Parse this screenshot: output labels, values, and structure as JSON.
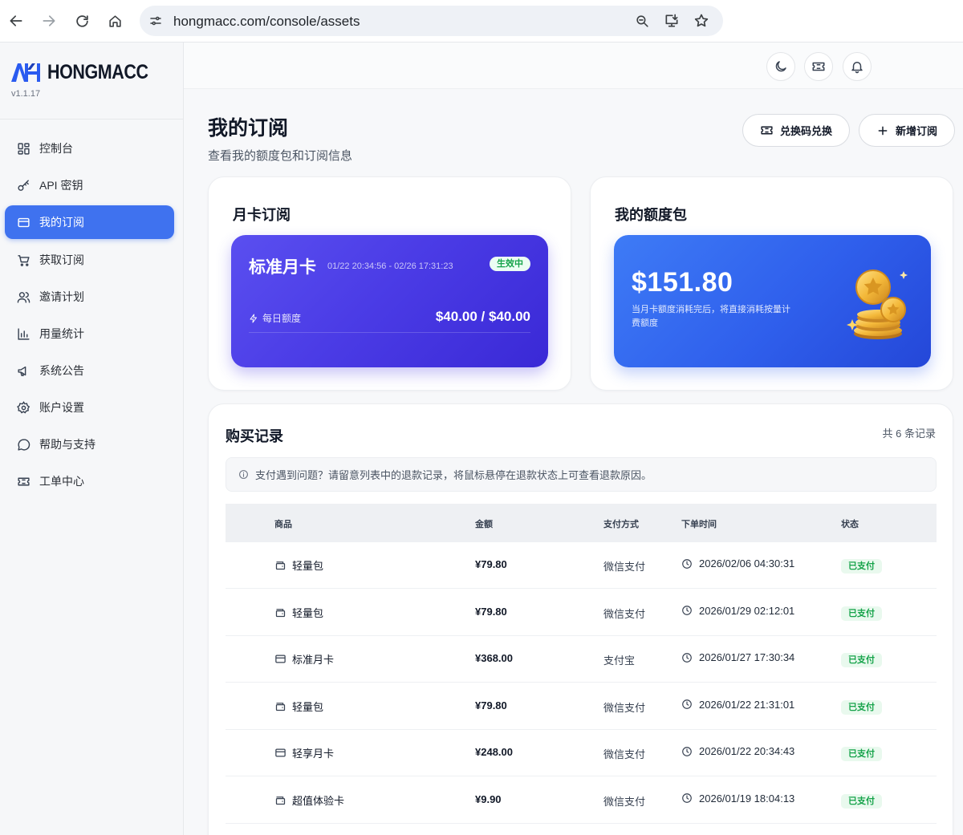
{
  "browser": {
    "url": "hongmacc.com/console/assets"
  },
  "brand": {
    "name": "HONGMACC",
    "version": "v1.1.17"
  },
  "sidebar": {
    "items": [
      {
        "label": "控制台",
        "icon": "dashboard-icon"
      },
      {
        "label": "API 密钥",
        "icon": "key-icon"
      },
      {
        "label": "我的订阅",
        "icon": "card-icon",
        "active": true
      },
      {
        "label": "获取订阅",
        "icon": "cart-icon"
      },
      {
        "label": "邀请计划",
        "icon": "users-icon"
      },
      {
        "label": "用量统计",
        "icon": "bar-chart-icon"
      },
      {
        "label": "系统公告",
        "icon": "megaphone-icon"
      },
      {
        "label": "账户设置",
        "icon": "gear-icon"
      },
      {
        "label": "帮助与支持",
        "icon": "chat-icon"
      },
      {
        "label": "工单中心",
        "icon": "ticket-icon"
      }
    ]
  },
  "page": {
    "title": "我的订阅",
    "subtitle": "查看我的额度包和订阅信息",
    "redeem_label": "兑换码兑换",
    "add_label": "新增订阅"
  },
  "subscription": {
    "title": "月卡订阅",
    "plan_name": "标准月卡",
    "range": "01/22 20:34:56 - 02/26 17:31:23",
    "status": "生效中",
    "daily_label": "每日额度",
    "daily_value": "$40.00 / $40.00"
  },
  "quota": {
    "title": "我的额度包",
    "amount": "$151.80",
    "note": "当月卡额度消耗完后，将直接消耗按量计费额度"
  },
  "records": {
    "title": "购买记录",
    "count": "共 6 条记录",
    "notice": "支付遇到问题？请留意列表中的退款记录，将鼠标悬停在退款状态上可查看退款原因。",
    "columns": {
      "product": "商品",
      "amount": "金额",
      "payment": "支付方式",
      "time": "下单时间",
      "status": "状态"
    },
    "rows": [
      {
        "product": "轻量包",
        "icon": "wallet-icon",
        "amount": "¥79.80",
        "payment": "微信支付",
        "time": "2026/02/06 04:30:31",
        "status": "已支付"
      },
      {
        "product": "轻量包",
        "icon": "wallet-icon",
        "amount": "¥79.80",
        "payment": "微信支付",
        "time": "2026/01/29 02:12:01",
        "status": "已支付"
      },
      {
        "product": "标准月卡",
        "icon": "card-icon",
        "amount": "¥368.00",
        "payment": "支付宝",
        "time": "2026/01/27 17:30:34",
        "status": "已支付"
      },
      {
        "product": "轻量包",
        "icon": "wallet-icon",
        "amount": "¥79.80",
        "payment": "微信支付",
        "time": "2026/01/22 21:31:01",
        "status": "已支付"
      },
      {
        "product": "轻享月卡",
        "icon": "card-icon",
        "amount": "¥248.00",
        "payment": "微信支付",
        "time": "2026/01/22 20:34:43",
        "status": "已支付"
      },
      {
        "product": "超值体验卡",
        "icon": "wallet-icon",
        "amount": "¥9.90",
        "payment": "微信支付",
        "time": "2026/01/19 18:04:13",
        "status": "已支付"
      }
    ]
  },
  "colors": {
    "accent": "#3f72ef",
    "subscription_gradient": "#4b3ce6",
    "quota_gradient": "#2f5fec",
    "status_green": "#16a34a"
  }
}
